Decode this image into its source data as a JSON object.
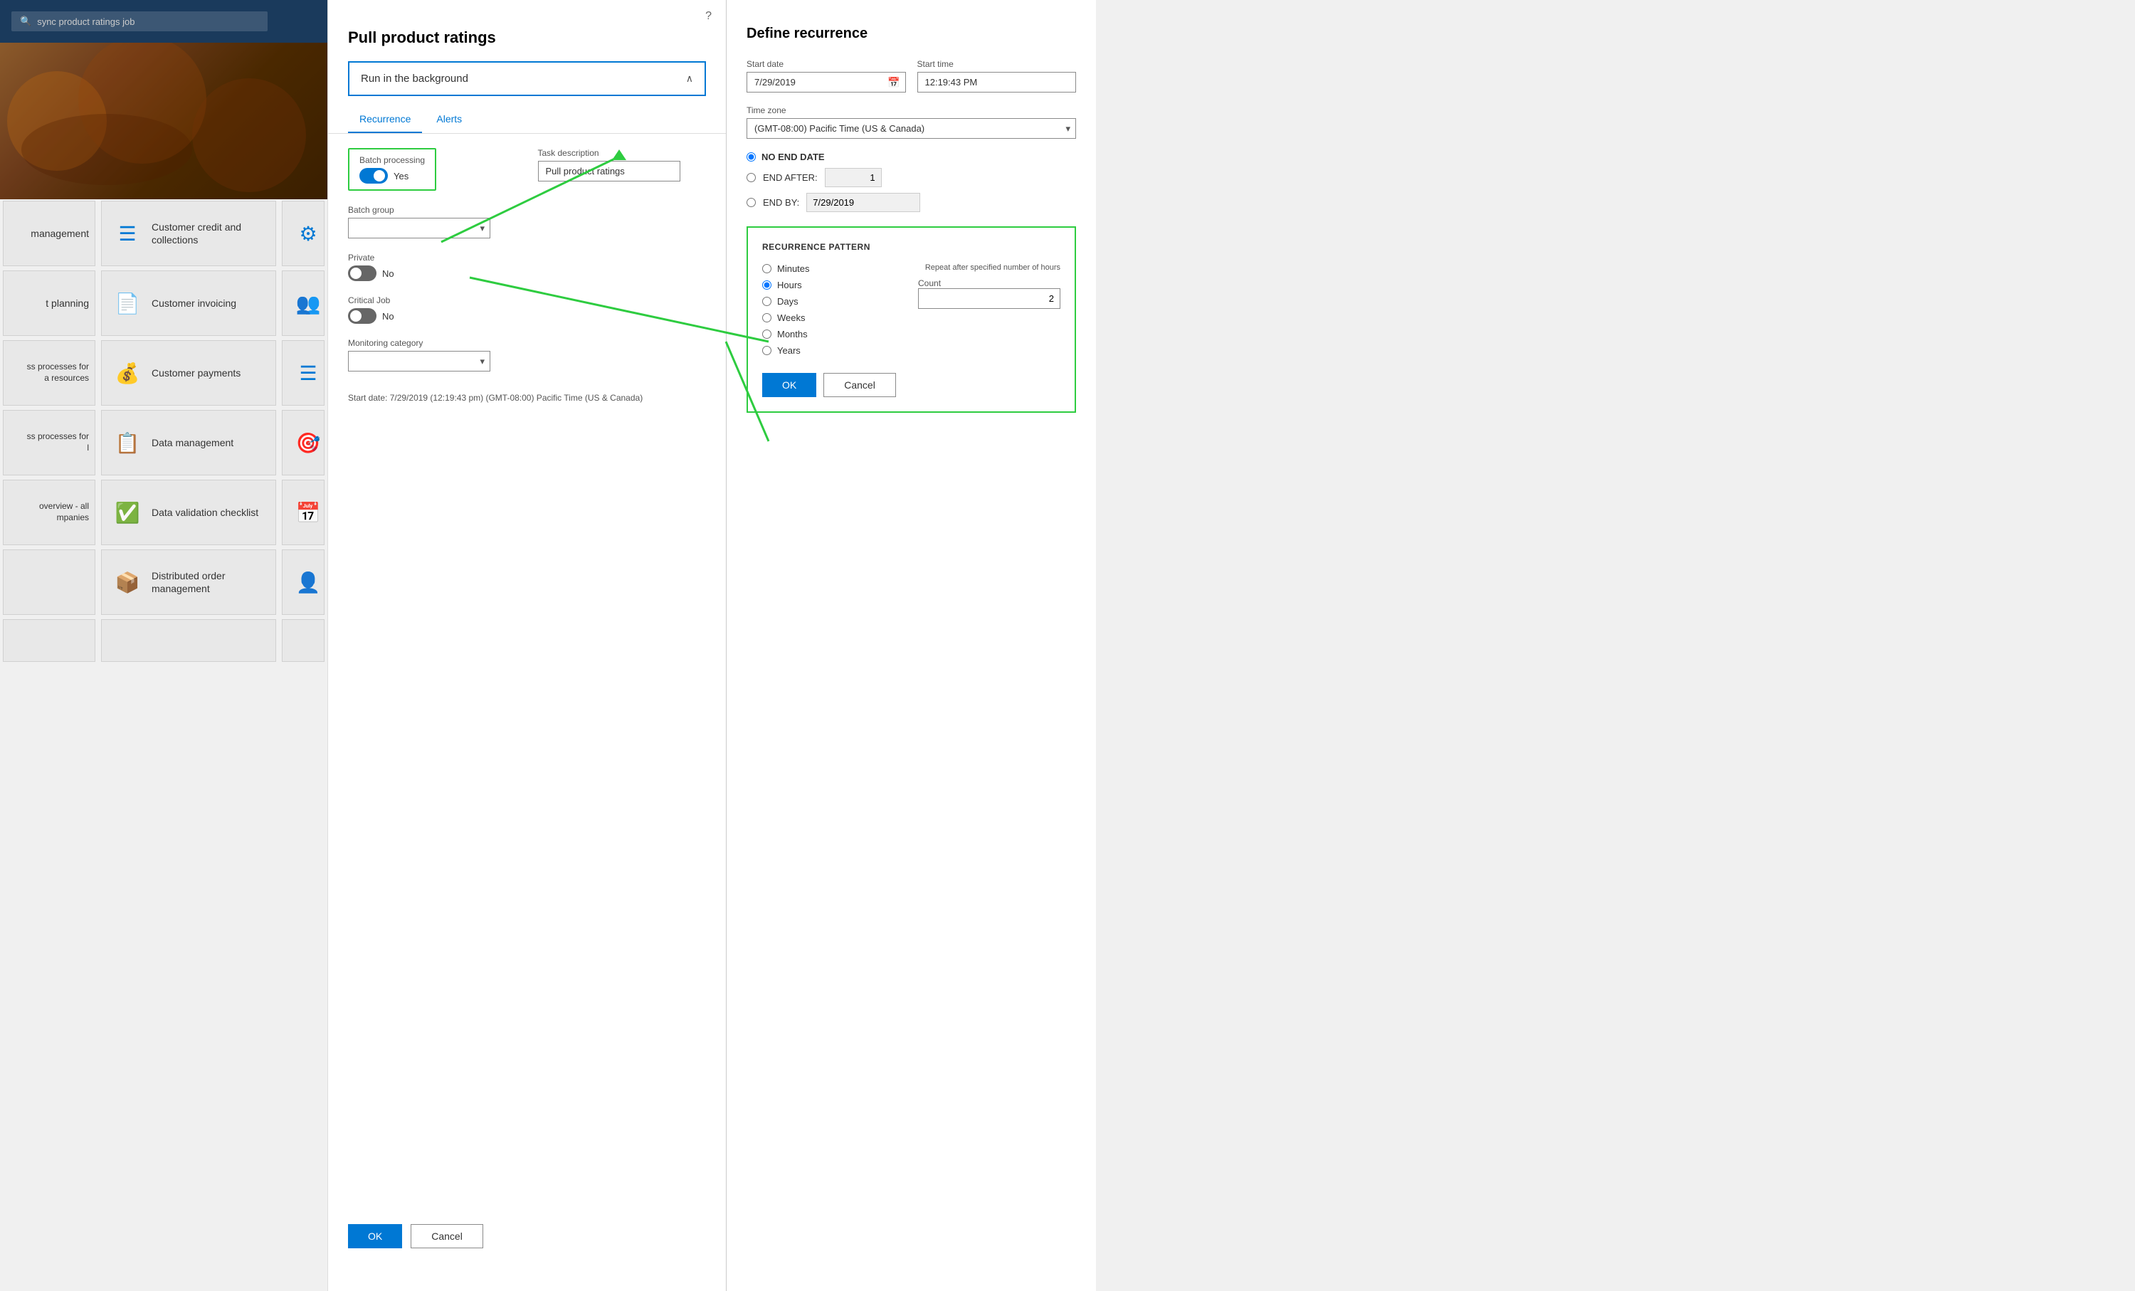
{
  "topbar": {
    "search_placeholder": "sync product ratings job"
  },
  "tiles": [
    {
      "id": "management",
      "label": "management",
      "partial": true
    },
    {
      "id": "customer-credit",
      "label": "Customer credit and\ncollections"
    },
    {
      "id": "customer-invoicing",
      "label": "Customer invoicing"
    },
    {
      "id": "customer-payments",
      "label": "Customer payments"
    },
    {
      "id": "data-management",
      "label": "Data management"
    },
    {
      "id": "data-validation",
      "label": "Data validation checklist"
    },
    {
      "id": "distributed-order",
      "label": "Distributed order\nmanagement"
    },
    {
      "id": "t-planning",
      "label": "t planning",
      "partial": true
    },
    {
      "id": "ss-processes-hr",
      "label": "ss processes for\na resources",
      "partial": true
    },
    {
      "id": "ss-processes",
      "label": "ss processes for\nl",
      "partial": true
    },
    {
      "id": "overview-all",
      "label": "overview - all\nmpanies",
      "partial": true
    }
  ],
  "pull_dialog": {
    "title": "Pull product ratings",
    "help_icon": "?",
    "run_in_background": "Run in the background",
    "tabs": [
      {
        "id": "recurrence",
        "label": "Recurrence",
        "active": true
      },
      {
        "id": "alerts",
        "label": "Alerts",
        "active": false
      }
    ],
    "batch_processing": {
      "label": "Batch processing",
      "value": "Yes",
      "enabled": true
    },
    "task_description": {
      "label": "Task description",
      "value": "Pull product ratings"
    },
    "batch_group": {
      "label": "Batch group",
      "value": ""
    },
    "private": {
      "label": "Private",
      "value": "No",
      "enabled": false
    },
    "critical_job": {
      "label": "Critical Job",
      "value": "No",
      "enabled": false
    },
    "monitoring_category": {
      "label": "Monitoring category",
      "value": ""
    },
    "start_date_info": "Start date: 7/29/2019 (12:19:43 pm) (GMT-08:00) Pacific Time (US & Canada)",
    "ok_label": "OK",
    "cancel_label": "Cancel"
  },
  "define_recurrence": {
    "title": "Define recurrence",
    "start_date": {
      "label": "Start date",
      "value": "7/29/2019"
    },
    "start_time": {
      "label": "Start time",
      "value": "12:19:43 PM"
    },
    "time_zone": {
      "label": "Time zone",
      "value": "(GMT-08:00) Pacific Time (US & Canada)"
    },
    "end_options": {
      "no_end_date": {
        "label": "NO END DATE",
        "selected": true
      },
      "end_after": {
        "label": "END AFTER:",
        "selected": false,
        "count": "1"
      },
      "end_by": {
        "label": "END BY:",
        "selected": false,
        "date": "7/29/2019"
      }
    },
    "recurrence_pattern": {
      "title": "RECURRENCE PATTERN",
      "repeat_label": "Repeat after specified number of hours",
      "count_label": "Count",
      "count_value": "2",
      "options": [
        {
          "id": "minutes",
          "label": "Minutes",
          "selected": false
        },
        {
          "id": "hours",
          "label": "Hours",
          "selected": true
        },
        {
          "id": "days",
          "label": "Days",
          "selected": false
        },
        {
          "id": "weeks",
          "label": "Weeks",
          "selected": false
        },
        {
          "id": "months",
          "label": "Months",
          "selected": false
        },
        {
          "id": "years",
          "label": "Years",
          "selected": false
        }
      ]
    },
    "ok_label": "OK",
    "cancel_label": "Cancel"
  }
}
